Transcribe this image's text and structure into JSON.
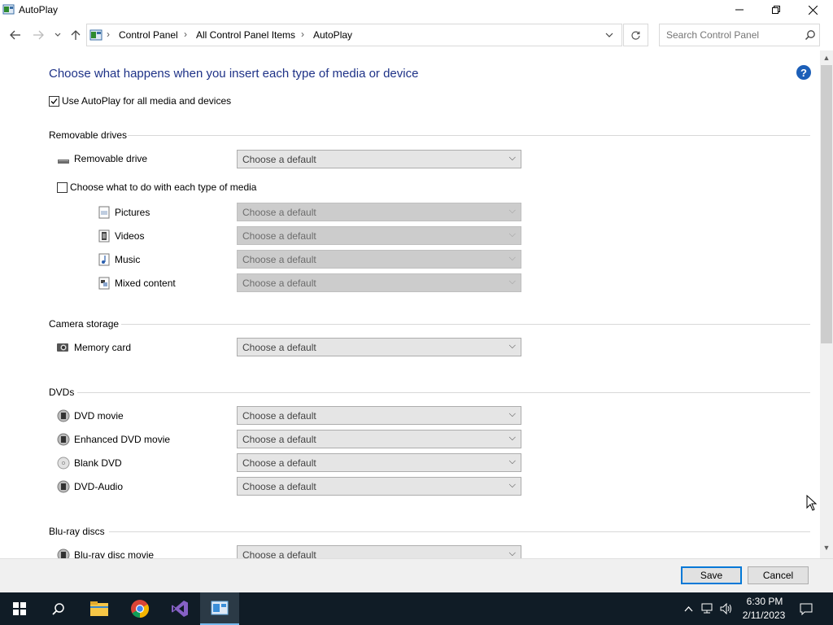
{
  "window": {
    "title": "AutoPlay",
    "minimize": "minimize",
    "restore": "restore",
    "close": "close"
  },
  "address": {
    "crumbs": [
      "Control Panel",
      "All Control Panel Items",
      "AutoPlay"
    ],
    "search_placeholder": "Search Control Panel"
  },
  "content": {
    "heading": "Choose what happens when you insert each type of media or device",
    "use_autoplay_label": "Use AutoPlay for all media and devices",
    "use_autoplay_checked": true,
    "sections": {
      "removable": {
        "title": "Removable drives",
        "drive_label": "Removable drive",
        "drive_value": "Choose a default",
        "each_type_label": "Choose what to do with each type of media",
        "each_type_checked": false,
        "media": [
          {
            "label": "Pictures",
            "value": "Choose a default",
            "icon": "pictures-icon"
          },
          {
            "label": "Videos",
            "value": "Choose a default",
            "icon": "videos-icon"
          },
          {
            "label": "Music",
            "value": "Choose a default",
            "icon": "music-icon"
          },
          {
            "label": "Mixed content",
            "value": "Choose a default",
            "icon": "mixed-content-icon"
          }
        ]
      },
      "camera": {
        "title": "Camera storage",
        "items": [
          {
            "label": "Memory card",
            "value": "Choose a default"
          }
        ]
      },
      "dvds": {
        "title": "DVDs",
        "items": [
          {
            "label": "DVD movie",
            "value": "Choose a default"
          },
          {
            "label": "Enhanced DVD movie",
            "value": "Choose a default"
          },
          {
            "label": "Blank DVD",
            "value": "Choose a default"
          },
          {
            "label": "DVD-Audio",
            "value": "Choose a default"
          }
        ]
      },
      "bluray": {
        "title": "Blu-ray discs",
        "items": [
          {
            "label": "Blu-ray disc movie",
            "value": "Choose a default"
          }
        ]
      }
    }
  },
  "footer": {
    "save": "Save",
    "cancel": "Cancel"
  },
  "taskbar": {
    "time": "6:30 PM",
    "date": "2/11/2023"
  },
  "colors": {
    "heading": "#1e3287",
    "accent": "#0078d7",
    "taskbar": "#101c26"
  }
}
